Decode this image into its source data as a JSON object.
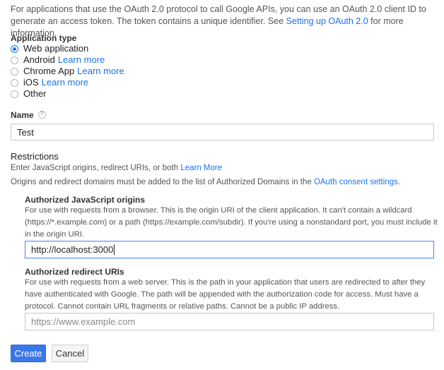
{
  "intro": {
    "text": "For applications that use the OAuth 2.0 protocol to call Google APIs, you can use an OAuth 2.0 client ID to generate an access token. The token contains a unique identifier. See ",
    "link": "Setting up OAuth 2.0",
    "suffix": " for more information."
  },
  "application_type": {
    "label": "Application type",
    "options": [
      {
        "label": "Web application",
        "link": "",
        "checked": true
      },
      {
        "label": "Android",
        "link": "Learn more",
        "checked": false
      },
      {
        "label": "Chrome App",
        "link": "Learn more",
        "checked": false
      },
      {
        "label": "iOS",
        "link": "Learn more",
        "checked": false
      },
      {
        "label": "Other",
        "link": "",
        "checked": false
      }
    ]
  },
  "name": {
    "label": "Name",
    "value": "Test"
  },
  "restrictions": {
    "title": "Restrictions",
    "line1": "Enter JavaScript origins, redirect URIs, or both ",
    "line1_link": "Learn More",
    "line2": "Origins and redirect domains must be added to the list of Authorized Domains in the ",
    "line2_link": "OAuth consent settings",
    "line2_suffix": "."
  },
  "js_origins": {
    "title": "Authorized JavaScript origins",
    "description": "For use with requests from a browser. This is the origin URI of the client application. It can't contain a wildcard (https://*.example.com) or a path (https://example.com/subdir). If you're using a nonstandard port, you must include it in the origin URI.",
    "value": "http://localhost:3000"
  },
  "redirect_uris": {
    "title": "Authorized redirect URIs",
    "description": "For use with requests from a web server. This is the path in your application that users are redirected to after they have authenticated with Google. The path will be appended with the authorization code for access. Must have a protocol. Cannot contain URL fragments or relative paths. Cannot be a public IP address.",
    "placeholder": "https://www.example.com"
  },
  "buttons": {
    "create": "Create",
    "cancel": "Cancel"
  },
  "colors": {
    "accent": "#1a73e8",
    "primary_button": "#3b78e7",
    "focus_border": "#4285f4"
  }
}
